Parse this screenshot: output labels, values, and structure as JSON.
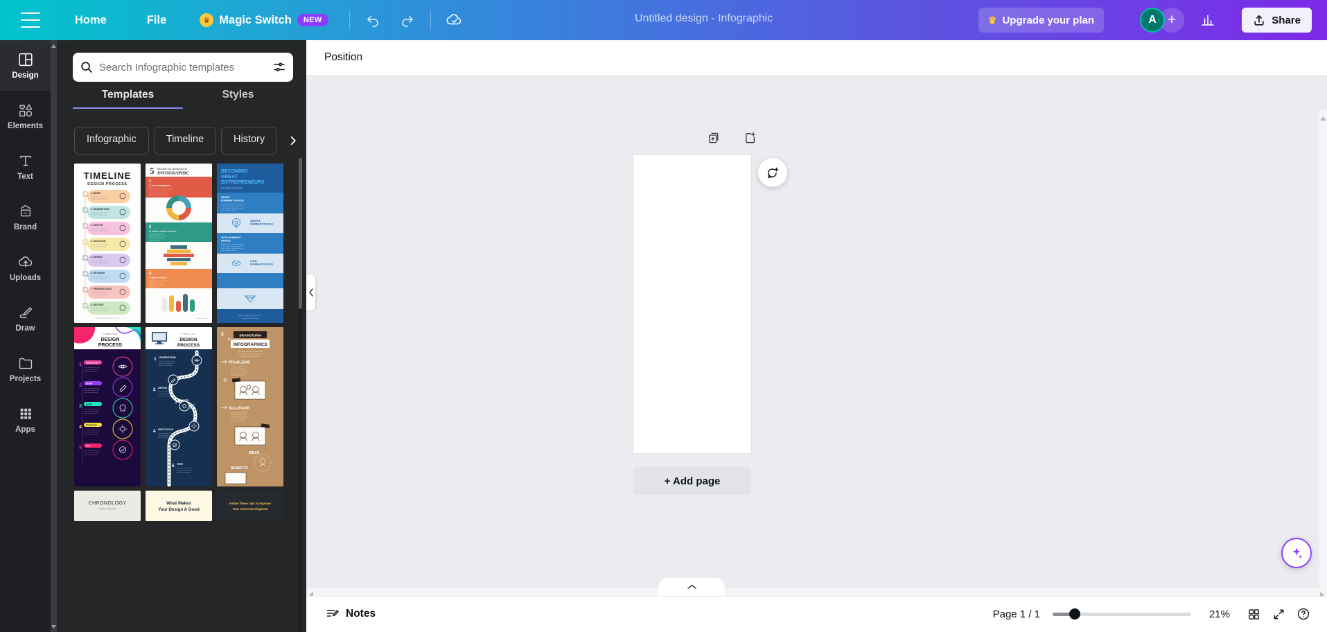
{
  "topbar": {
    "menu_icon": "hamburger-icon",
    "home": "Home",
    "file": "File",
    "magic_switch": "Magic Switch",
    "magic_switch_badge": "NEW",
    "crown_icon": "crown-icon",
    "undo_icon": "undo-icon",
    "redo_icon": "redo-icon",
    "cloud_saved_icon": "cloud-check-icon",
    "doc_title": "Untitled design - Infographic",
    "upgrade": "Upgrade your plan",
    "avatar_initial": "A",
    "add_collaborator": "+",
    "analytics_icon": "bar-chart-icon",
    "share": "Share",
    "share_icon": "share-upload-icon",
    "accent_new_badge": "#8b3dff",
    "gradient_start": "#00c4cc",
    "gradient_end": "#7d2ae8"
  },
  "rail": {
    "items": [
      {
        "label": "Design",
        "icon": "design-layout-icon",
        "active": true
      },
      {
        "label": "Elements",
        "icon": "shapes-icon",
        "active": false
      },
      {
        "label": "Text",
        "icon": "text-t-icon",
        "active": false
      },
      {
        "label": "Brand",
        "icon": "brand-card-icon",
        "active": false
      },
      {
        "label": "Uploads",
        "icon": "cloud-upload-icon",
        "active": false
      },
      {
        "label": "Draw",
        "icon": "pencil-draw-icon",
        "active": false
      },
      {
        "label": "Projects",
        "icon": "folder-icon",
        "active": false
      },
      {
        "label": "Apps",
        "icon": "grid-dots-icon",
        "active": false
      }
    ]
  },
  "panel": {
    "search": {
      "placeholder": "Search Infographic templates",
      "value": "",
      "search_icon": "search-icon",
      "filter_icon": "filter-sliders-icon"
    },
    "tabs": [
      {
        "label": "Templates",
        "active": true
      },
      {
        "label": "Styles",
        "active": false
      }
    ],
    "chips": [
      "Infographic",
      "Timeline",
      "History"
    ],
    "chip_next_icon": "chevron-right-icon",
    "templates": [
      {
        "title": "TIMELINE",
        "subtitle": "DESIGN PROCESS",
        "style": "timeline-pastel"
      },
      {
        "title": "5 Reasons you should use an",
        "subtitle": "INFOGRAPHIC",
        "style": "five-reasons"
      },
      {
        "title": "BECOMING GREAT ENTREPRENEURS",
        "subtitle": "Top Traits of the Greats",
        "style": "entrepreneurs-blue"
      },
      {
        "title": "DESIGN PROCESS",
        "subtitle": "TIMELINE",
        "style": "neon-circles-dark"
      },
      {
        "title": "DESIGN PROCESS",
        "subtitle": "TIMELINE",
        "style": "navy-road-map"
      },
      {
        "title": "BRAINSTORM INFOGRAPHICS",
        "subtitle": "",
        "style": "kraft-sketch"
      },
      {
        "title": "CHRONOLOGY",
        "subtitle": "timeline infographic",
        "style": "chronology-light"
      },
      {
        "title": "What Makes Your Design A Good",
        "subtitle": "",
        "style": "cream-article"
      },
      {
        "title": "Follow These Tips To Improve Your Career Development",
        "subtitle": "",
        "style": "dark-tips"
      }
    ]
  },
  "editor": {
    "position_label": "Position",
    "duplicate_page_icon": "duplicate-page-icon",
    "add_page_icon": "add-page-icon",
    "comment_icon": "add-comment-icon",
    "add_page_label": "+ Add page",
    "collapse_icon": "chevron-up-icon",
    "panel_collapse_icon": "chevron-left-icon",
    "magic_fab_icon": "magic-sparkle-icon"
  },
  "bottombar": {
    "notes": "Notes",
    "notes_icon": "notes-icon",
    "page_count": "Page 1 / 1",
    "zoom_value": "21%",
    "grid_view_icon": "grid-view-icon",
    "fullscreen_icon": "expand-fullscreen-icon",
    "help_icon": "help-question-icon"
  }
}
